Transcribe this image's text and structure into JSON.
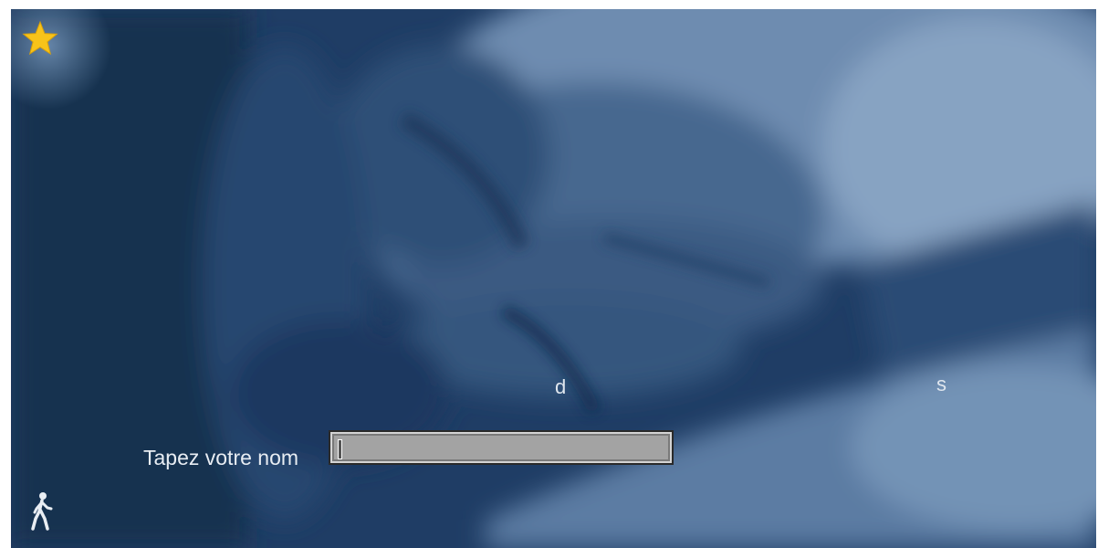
{
  "scene": {
    "background": "blurred-blue-tinted-photo"
  },
  "toolbar": {
    "star_icon": "star-icon",
    "exit_icon": "walking-person-icon",
    "star_color": "#f7c31a"
  },
  "letters": {
    "d": "d",
    "s": "s"
  },
  "name_prompt": {
    "label": "Tapez votre nom",
    "value": ""
  }
}
